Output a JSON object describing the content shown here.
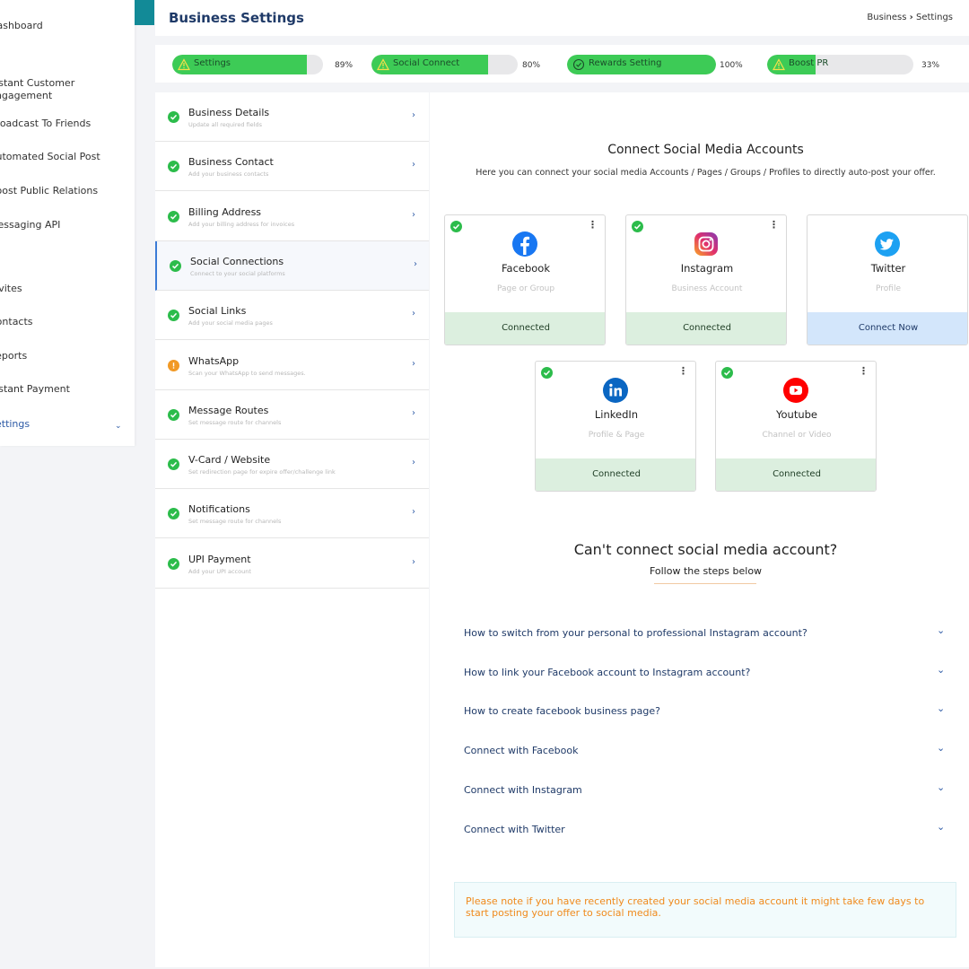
{
  "sidebar": {
    "items": [
      {
        "label": "Dashboard"
      },
      {
        "label": "Instant Customer"
      },
      {
        "label": "Engagement"
      },
      {
        "label": "Broadcast To Friends"
      },
      {
        "label": "Automated Social Post"
      },
      {
        "label": "Boost Public Relations"
      },
      {
        "label": "Messaging API"
      },
      {
        "label": "Invites"
      },
      {
        "label": "Contacts"
      },
      {
        "label": "Reports"
      },
      {
        "label": "Instant Payment"
      },
      {
        "label": "Settings"
      }
    ]
  },
  "header": {
    "title": "Business Settings",
    "crumb_root": "Business",
    "crumb_sep": "›",
    "crumb_current": "Settings"
  },
  "progress": [
    {
      "label": "Settings",
      "percent_text": "89%",
      "value": 0.89,
      "icon": "warning-icon"
    },
    {
      "label": "Social Connect",
      "percent_text": "80%",
      "value": 0.8,
      "icon": "warning-icon"
    },
    {
      "label": "Rewards Setting",
      "percent_text": "100%",
      "value": 1.0,
      "icon": "check-circle-icon"
    },
    {
      "label": "Boost PR",
      "percent_text": "33%",
      "value": 0.33,
      "icon": "warning-icon"
    }
  ],
  "steps": [
    {
      "title": "Business Details",
      "sub": "Update all required fields",
      "status": "done"
    },
    {
      "title": "Business Contact",
      "sub": "Add your business contacts",
      "status": "done"
    },
    {
      "title": "Billing Address",
      "sub": "Add your billing address for invoices",
      "status": "done"
    },
    {
      "title": "Social Connections",
      "sub": "Connect to your social platforms",
      "status": "done"
    },
    {
      "title": "Social Links",
      "sub": "Add your social media pages",
      "status": "done"
    },
    {
      "title": "WhatsApp",
      "sub": "Scan your WhatsApp to send messages.",
      "status": "warning"
    },
    {
      "title": "Message Routes",
      "sub": "Set message route for channels",
      "status": "done"
    },
    {
      "title": "V-Card / Website",
      "sub": "Set redirection page for expire offer/challenge link",
      "status": "done"
    },
    {
      "title": "Notifications",
      "sub": "Set message route for channels",
      "status": "done"
    },
    {
      "title": "UPI Payment",
      "sub": "Add your UPI account",
      "status": "done"
    }
  ],
  "content": {
    "title": "Connect Social Media Accounts",
    "desc": "Here you can connect your social media Accounts / Pages / Groups / Profiles to directly auto-post your offer.",
    "cards": [
      {
        "name": "Facebook",
        "sub": "Page or Group",
        "status": "Connected",
        "connected": true,
        "icon": "facebook-icon",
        "color": "#1877f2"
      },
      {
        "name": "Instagram",
        "sub": "Business Account",
        "status": "Connected",
        "connected": true,
        "icon": "instagram-icon",
        "color": "#e1306c"
      },
      {
        "name": "Twitter",
        "sub": "Profile",
        "status": "Connect Now",
        "connected": false,
        "icon": "twitter-icon",
        "color": "#1da1f2"
      },
      {
        "name": "LinkedIn",
        "sub": "Profile & Page",
        "status": "Connected",
        "connected": true,
        "icon": "linkedin-icon",
        "color": "#0a66c2"
      },
      {
        "name": "Youtube",
        "sub": "Channel or Video",
        "status": "Connected",
        "connected": true,
        "icon": "youtube-icon",
        "color": "#ff0000"
      }
    ],
    "cant_title": "Can't connect social media account?",
    "cant_sub": "Follow the steps below",
    "faqs": [
      "How to switch from your personal to professional Instagram account?",
      "How to link your Facebook account to Instagram account?",
      "How to create facebook business page?",
      "Connect with Facebook",
      "Connect with Instagram",
      "Connect with Twitter"
    ],
    "note": "Please note if you have recently created your social media account it might take few days to start posting your offer to social media."
  },
  "colors": {
    "accent": "#1f3a68",
    "success": "#2cbc4b",
    "warning": "#f19925",
    "teal": "#128a97"
  }
}
